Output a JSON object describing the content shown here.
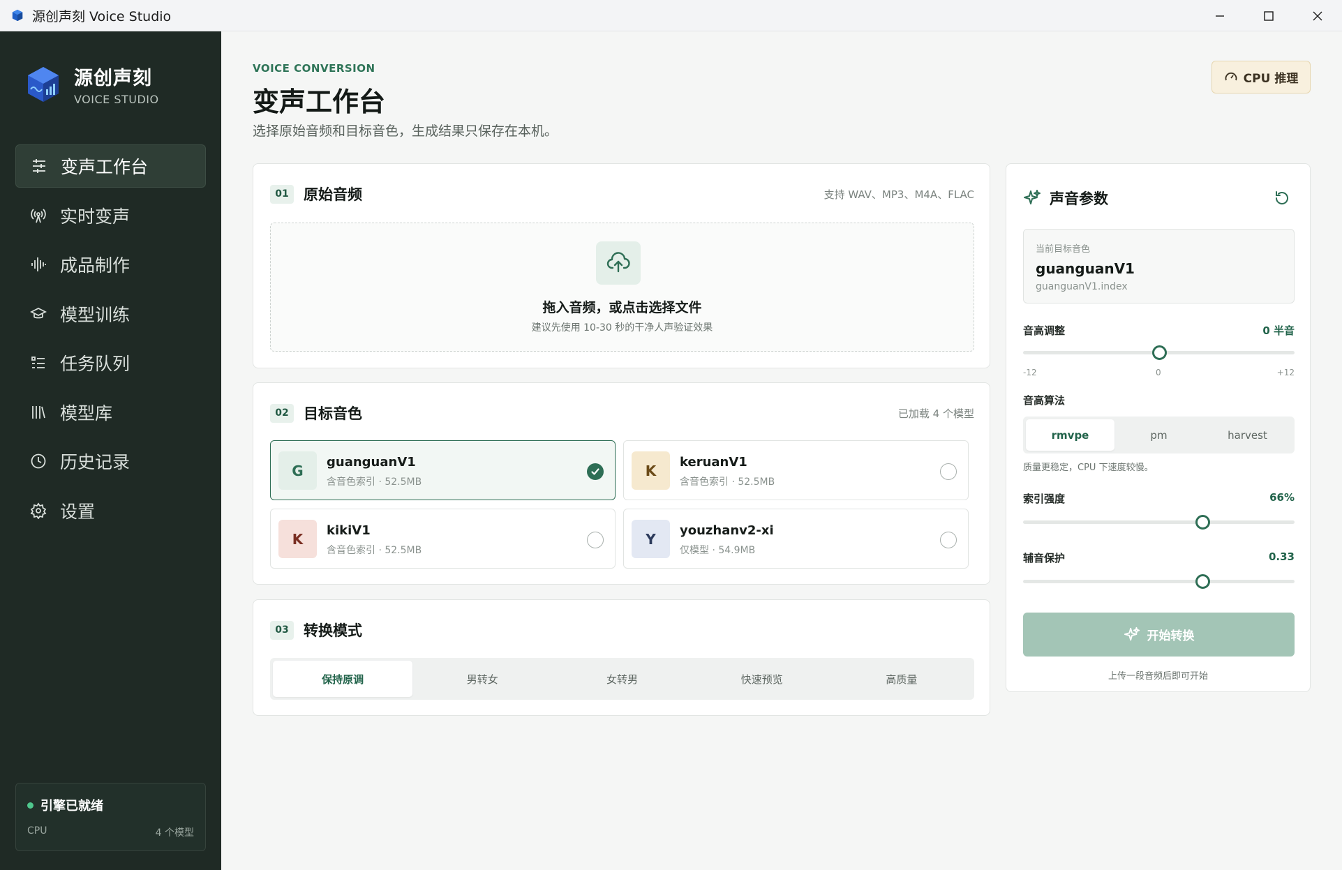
{
  "window": {
    "title": "源创声刻 Voice Studio",
    "controls": [
      "minimize",
      "maximize",
      "close"
    ]
  },
  "sidebar": {
    "brand_name": "源创声刻",
    "brand_sub": "VOICE STUDIO",
    "items": [
      {
        "label": "变声工作台",
        "icon": "sliders-icon",
        "active": true
      },
      {
        "label": "实时变声",
        "icon": "broadcast-icon",
        "active": false
      },
      {
        "label": "成品制作",
        "icon": "waveform-icon",
        "active": false
      },
      {
        "label": "模型训练",
        "icon": "graduation-cap-icon",
        "active": false
      },
      {
        "label": "任务队列",
        "icon": "task-list-icon",
        "active": false
      },
      {
        "label": "模型库",
        "icon": "library-icon",
        "active": false
      },
      {
        "label": "历史记录",
        "icon": "clock-icon",
        "active": false
      },
      {
        "label": "设置",
        "icon": "gear-icon",
        "active": false
      }
    ],
    "engine": {
      "status": "引擎已就绪",
      "device": "CPU",
      "models": "4 个模型",
      "status_color": "#4fc78d"
    }
  },
  "header": {
    "eyebrow": "VOICE CONVERSION",
    "title": "变声工作台",
    "subtitle": "选择原始音频和目标音色，生成结果只保存在本机。",
    "badge": "CPU 推理"
  },
  "source": {
    "step": "01",
    "title": "原始音频",
    "note": "支持 WAV、MP3、M4A、FLAC",
    "drop_title": "拖入音频，或点击选择文件",
    "drop_sub": "建议先使用 10-30 秒的干净人声验证效果"
  },
  "target": {
    "step": "02",
    "title": "目标音色",
    "note": "已加载 4 个模型",
    "voices": [
      {
        "initial": "G",
        "name": "guanguanV1",
        "meta": "含音色索引 · 52.5MB",
        "selected": true
      },
      {
        "initial": "K",
        "name": "keruanV1",
        "meta": "含音色索引 · 52.5MB",
        "selected": false
      },
      {
        "initial": "K",
        "name": "kikiV1",
        "meta": "含音色索引 · 52.5MB",
        "selected": false
      },
      {
        "initial": "Y",
        "name": "youzhanv2-xi",
        "meta": "仅模型 · 54.9MB",
        "selected": false
      }
    ]
  },
  "mode": {
    "step": "03",
    "title": "转换模式",
    "options": [
      "保持原调",
      "男转女",
      "女转男",
      "快速预览",
      "高质量"
    ],
    "selected": "保持原调"
  },
  "params": {
    "title": "声音参数",
    "target_label": "当前目标音色",
    "target_name": "guanguanV1",
    "target_file": "guanguanV1.index",
    "pitch": {
      "label": "音高调整",
      "value_text": "0 半音",
      "min": "-12",
      "mid": "0",
      "max": "+12",
      "value": 0
    },
    "algorithm": {
      "label": "音高算法",
      "options": [
        "rmvpe",
        "pm",
        "harvest"
      ],
      "selected": "rmvpe",
      "hint": "质量更稳定，CPU 下速度较慢。"
    },
    "index_strength": {
      "label": "索引强度",
      "value_text": "66%",
      "value": 0.66
    },
    "protect": {
      "label": "辅音保护",
      "value_text": "0.33",
      "value": 0.33
    },
    "start_label": "开始转换",
    "start_hint": "上传一段音频后即可开始"
  },
  "colors": {
    "accent": "#2e6e55",
    "sidebar_bg": "#1f2a25",
    "start_disabled": "#a3c5b6",
    "badge_bg": "#f8f0de"
  }
}
